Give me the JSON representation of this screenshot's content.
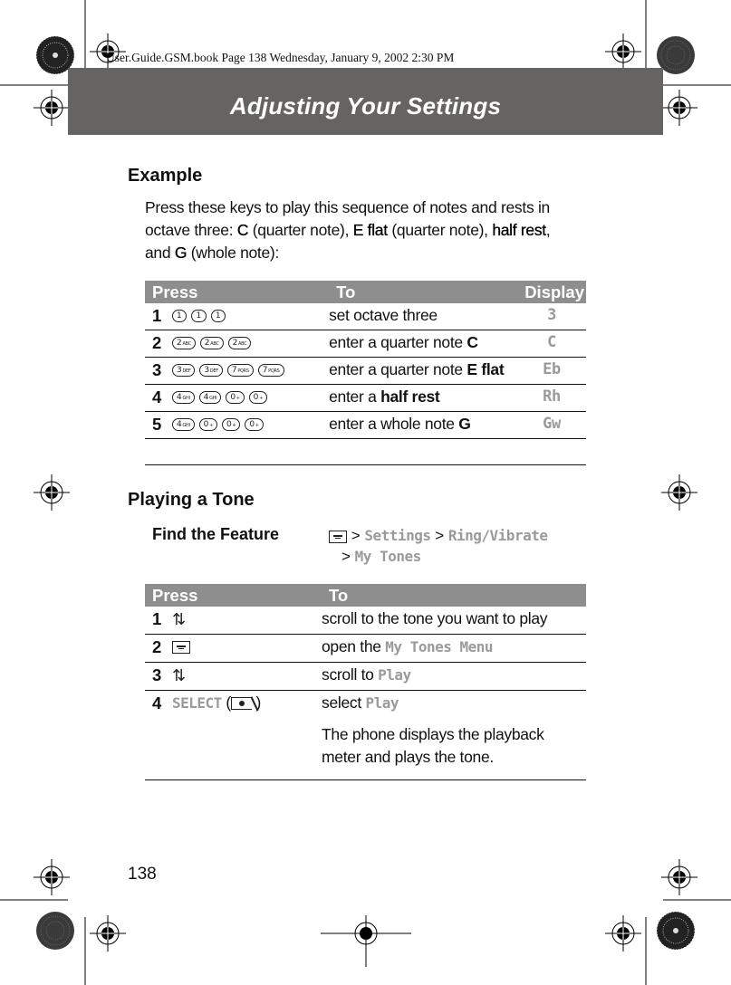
{
  "book_info": "User.Guide.GSM.book  Page 138  Wednesday, January 9, 2002  2:30 PM",
  "header": {
    "title": "Adjusting Your Settings"
  },
  "example": {
    "heading": "Example",
    "intro": {
      "p1": "Press these keys to play this sequence of notes and rests in octave three: ",
      "c": "C",
      "p2": " (quarter note), ",
      "eflat": "E flat",
      "p3": " (quarter note), ",
      "halfrest": "half rest",
      "p4": ", and ",
      "g": "G",
      "p5": " (whole note):"
    },
    "table": {
      "headers": {
        "press": "Press",
        "to": "To",
        "display": "Display"
      },
      "rows": [
        {
          "num": "1",
          "keys": [
            [
              "1",
              ""
            ],
            [
              "1",
              ""
            ],
            [
              "1",
              ""
            ]
          ],
          "to_text": "set octave three",
          "to_bold": "",
          "display": "3"
        },
        {
          "num": "2",
          "keys": [
            [
              "2",
              "ABC"
            ],
            [
              "2",
              "ABC"
            ],
            [
              "2",
              "ABC"
            ]
          ],
          "to_text": "enter a quarter note ",
          "to_bold": "C",
          "display": "C"
        },
        {
          "num": "3",
          "keys": [
            [
              "3",
              "DEF"
            ],
            [
              "3",
              "DEF"
            ],
            [
              "7",
              "PQRS"
            ],
            [
              "7",
              "PQRS"
            ]
          ],
          "to_text": "enter a quarter note ",
          "to_bold": "E flat",
          "display": "Eb"
        },
        {
          "num": "4",
          "keys": [
            [
              "4",
              "GHI"
            ],
            [
              "4",
              "GHI"
            ],
            [
              "0",
              "+"
            ],
            [
              "0",
              "+"
            ]
          ],
          "to_text": "enter a ",
          "to_bold": "half rest",
          "display": "Rh"
        },
        {
          "num": "5",
          "keys": [
            [
              "4",
              "GHI"
            ],
            [
              "0",
              "+"
            ],
            [
              "0",
              "+"
            ],
            [
              "0",
              "+"
            ]
          ],
          "to_text": "enter a whole note ",
          "to_bold": "G",
          "display": "Gw"
        }
      ]
    }
  },
  "playing": {
    "heading": "Playing a Tone",
    "find_feature": {
      "label": "Find the Feature",
      "sep": ">",
      "path": [
        "Settings",
        "Ring/Vibrate",
        "My Tones"
      ]
    },
    "table": {
      "headers": {
        "press": "Press",
        "to": "To"
      },
      "rows": [
        {
          "num": "1",
          "key_icon": "scroll-key",
          "to_text": "scroll to the tone you want to play",
          "to_lcd": ""
        },
        {
          "num": "2",
          "key_icon": "menu-key",
          "to_text": "open the ",
          "to_lcd": "My Tones Menu"
        },
        {
          "num": "3",
          "key_icon": "scroll-key",
          "to_text": "scroll to ",
          "to_lcd": "Play"
        },
        {
          "num": "4",
          "key_label": "SELECT",
          "key_icon": "select-key",
          "to_text": "select ",
          "to_lcd": "Play",
          "note": "The phone displays the playback meter and plays the tone."
        }
      ]
    }
  },
  "page_number": "138"
}
